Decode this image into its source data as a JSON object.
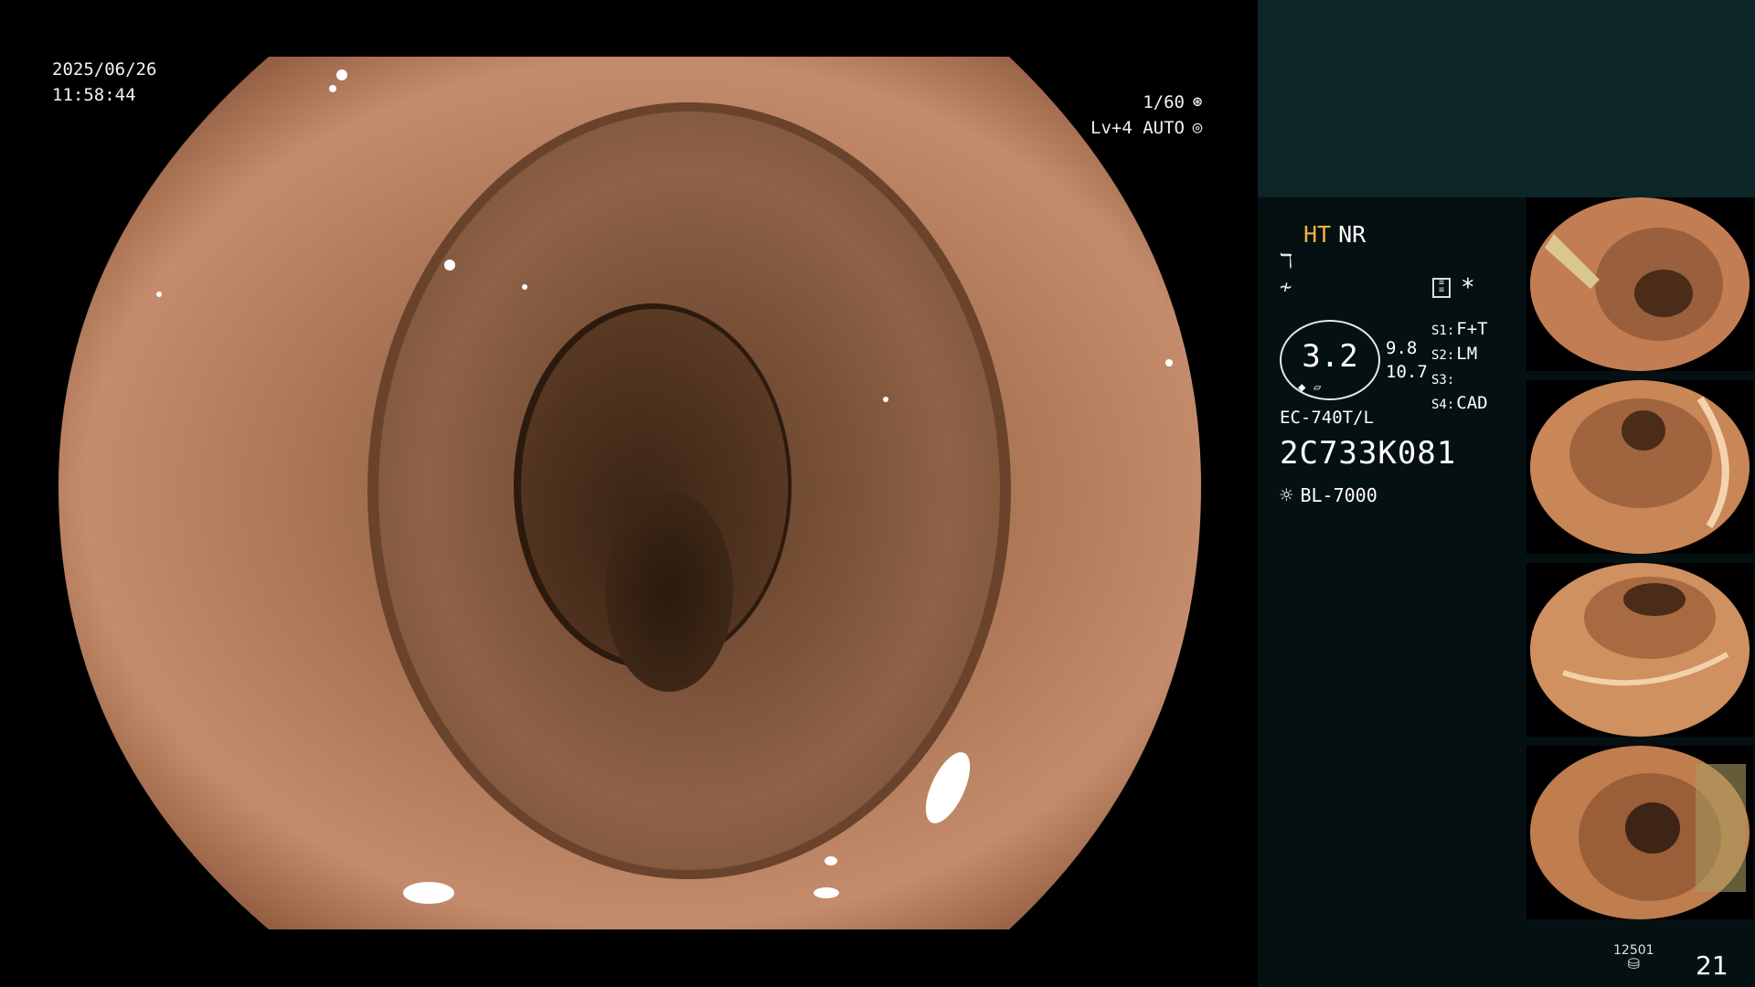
{
  "overlay": {
    "date": "2025/06/26",
    "time": "11:58:44",
    "shutter": "1/60",
    "shutter_icon": "aperture-icon",
    "level": "Lv+4 AUTO",
    "level_icon": "auto-iris-icon"
  },
  "info_panel": {
    "ht": "HT",
    "nr": "NR",
    "gauge_value": "3.2",
    "side_values": [
      "9.8",
      "10.7"
    ],
    "scope_slots": [
      {
        "label": "S1:",
        "value": "F+T"
      },
      {
        "label": "S2:",
        "value": "LM"
      },
      {
        "label": "S3:",
        "value": ""
      },
      {
        "label": "S4:",
        "value": "CAD"
      }
    ],
    "asterisk": "*",
    "model": "EC-740T/L",
    "serial": "2C733K081",
    "light_source": "BL-7000"
  },
  "footer": {
    "storage_count": "12501",
    "capture_count": "21"
  },
  "colors": {
    "ht": "#f0b23a",
    "panel_top": "#0c2526",
    "panel_bottom": "#051012"
  }
}
